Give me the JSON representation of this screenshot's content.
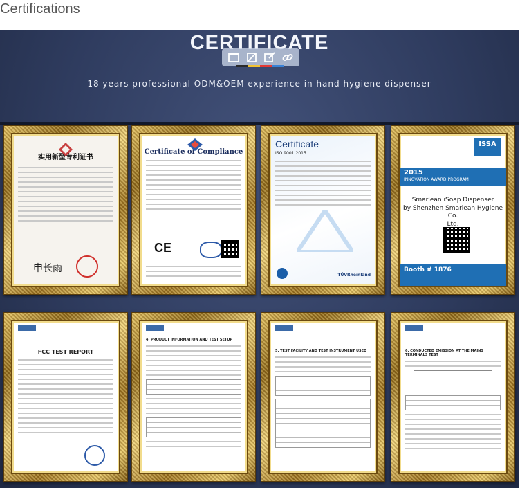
{
  "page": {
    "title": "Certifications"
  },
  "hero": {
    "heading": "CERTIFICATE",
    "subtitle": "18 years professional ODM&OEM experience in hand hygiene dispenser",
    "underline_colors": [
      "#2b2b2b",
      "#f2c230",
      "#e53935",
      "#3a82d6"
    ],
    "toolbar": [
      {
        "name": "image-icon"
      },
      {
        "name": "crop-icon"
      },
      {
        "name": "edit-icon"
      },
      {
        "name": "link-icon"
      }
    ]
  },
  "certificates": [
    {
      "id": "cert-utility-patent",
      "title_cn": "实用新型专利证书",
      "signature": "申长雨"
    },
    {
      "id": "cert-compliance",
      "title": "Certificate of Compliance",
      "mark": "CE"
    },
    {
      "id": "cert-iso",
      "title": "Certificate",
      "standard": "ISO 9001:2015",
      "footer": "TÜVRheinland"
    },
    {
      "id": "cert-issa-award",
      "badge_line1": "ISSA",
      "year": "2015",
      "program": "INNOVATION AWARD PROGRAM",
      "line1": "Smarlean iSoap Dispenser",
      "line2": "by Shenzhen Smarlean Hygiene Co.",
      "line3": "Ltd.",
      "booth": "Booth # 1876"
    },
    {
      "id": "cert-fcc-report",
      "title": "FCC TEST REPORT"
    },
    {
      "id": "cert-report-product-info",
      "title": "4. PRODUCT INFORMATION AND TEST SETUP"
    },
    {
      "id": "cert-report-test-facility",
      "title": "5. TEST FACILITY AND TEST INSTRUMENT USED"
    },
    {
      "id": "cert-report-conducted",
      "title": "6. CONDUCTED EMISSION AT THE MAINS TERMINALS TEST"
    }
  ],
  "colors": {
    "frame_gold": "#c9a23a",
    "hero_bg": "#2f3c5f",
    "award_blue": "#1f6fb4"
  }
}
